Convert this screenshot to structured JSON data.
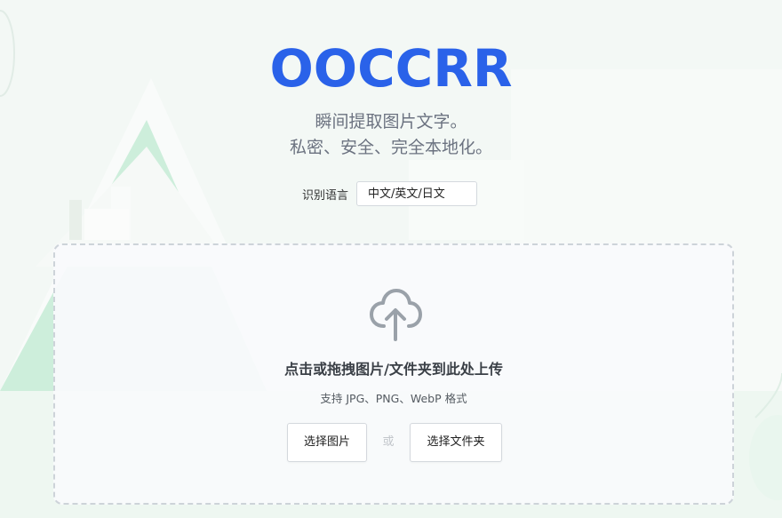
{
  "header": {
    "logo_text": "OOCCRR",
    "tagline_line1": "瞬间提取图片文字。",
    "tagline_line2": "私密、安全、完全本地化。"
  },
  "language": {
    "label": "识别语言",
    "selected": "中文/英文/日文"
  },
  "dropzone": {
    "title": "点击或拖拽图片/文件夹到此处上传",
    "subtitle": "支持 JPG、PNG、WebP 格式",
    "select_image_label": "选择图片",
    "or_label": "或",
    "select_folder_label": "选择文件夹"
  },
  "colors": {
    "brand": "#2a62e9",
    "icon": "#9aa1a9",
    "background_accent": "#cdeedb"
  },
  "icons": {
    "upload": "cloud-upload-icon"
  }
}
